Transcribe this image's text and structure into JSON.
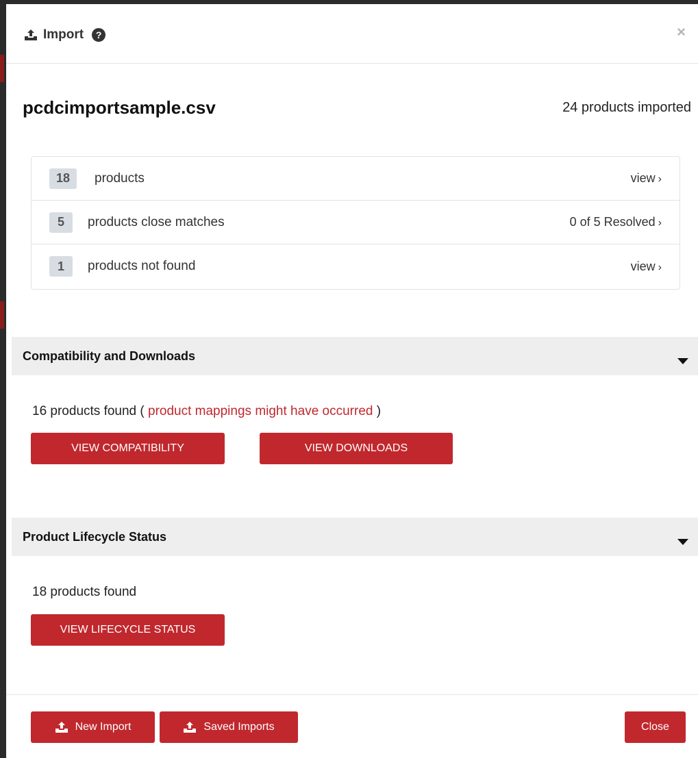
{
  "modal": {
    "title": "Import",
    "close_glyph": "×"
  },
  "file": {
    "name": "pcdcimportsample.csv",
    "imported_label": "24 products imported"
  },
  "summary": [
    {
      "count": "18",
      "label": "products",
      "link": "view",
      "chevron": "›"
    },
    {
      "count": "5",
      "label": "products close matches",
      "link": "0 of 5 Resolved",
      "chevron": "›"
    },
    {
      "count": "1",
      "label": "products not found",
      "link": "view",
      "chevron": "›"
    }
  ],
  "compatibility": {
    "title": "Compatibility and Downloads",
    "found_prefix": "16 products found ( ",
    "found_warning": "product mappings might have occurred",
    "found_suffix": " )",
    "view_compatibility_label": "VIEW COMPATIBILITY",
    "view_downloads_label": "VIEW DOWNLOADS"
  },
  "lifecycle": {
    "title": "Product Lifecycle Status",
    "found_text": "18 products found",
    "view_lifecycle_label": "VIEW LIFECYCLE STATUS"
  },
  "footer": {
    "new_import_label": "New Import",
    "saved_imports_label": "Saved Imports",
    "close_label": "Close"
  },
  "colors": {
    "accent_red": "#c0282d",
    "section_bg": "#eeeeee",
    "badge_bg": "#d8dde3"
  },
  "icons": {
    "upload": "upload-icon",
    "help": "question-circle-icon",
    "close": "close-icon",
    "caret": "caret-down-icon"
  }
}
